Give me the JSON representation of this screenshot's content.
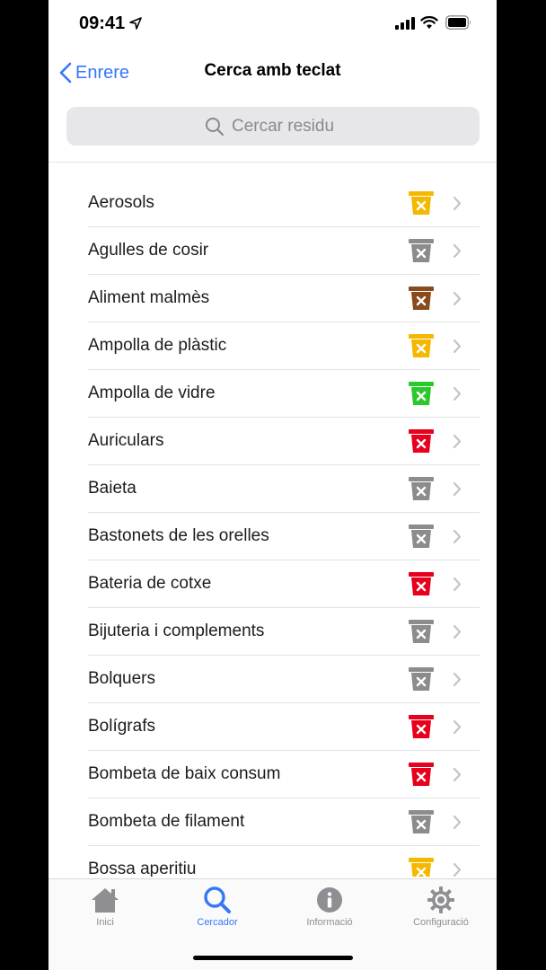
{
  "status_bar": {
    "time": "09:41"
  },
  "nav": {
    "back_label": "Enrere",
    "title": "Cerca amb teclat"
  },
  "search": {
    "placeholder": "Cercar residu"
  },
  "colors": {
    "yellow": "#f5b800",
    "gray": "#8c8c8c",
    "brown": "#8a4a1c",
    "green": "#2ac92a",
    "red": "#e8001c",
    "accent": "#3478f6"
  },
  "items": [
    {
      "label": "Aerosols",
      "bin": "yellow"
    },
    {
      "label": "Agulles de cosir",
      "bin": "gray"
    },
    {
      "label": "Aliment malmès",
      "bin": "brown"
    },
    {
      "label": "Ampolla de plàstic",
      "bin": "yellow"
    },
    {
      "label": "Ampolla de vidre",
      "bin": "green"
    },
    {
      "label": "Auriculars",
      "bin": "red"
    },
    {
      "label": "Baieta",
      "bin": "gray"
    },
    {
      "label": "Bastonets de les orelles",
      "bin": "gray"
    },
    {
      "label": "Bateria de cotxe",
      "bin": "red"
    },
    {
      "label": "Bijuteria i complements",
      "bin": "gray"
    },
    {
      "label": "Bolquers",
      "bin": "gray"
    },
    {
      "label": "Bolígrafs",
      "bin": "red"
    },
    {
      "label": "Bombeta de baix consum",
      "bin": "red"
    },
    {
      "label": "Bombeta de filament",
      "bin": "gray"
    },
    {
      "label": "Bossa aperitiu",
      "bin": "yellow"
    }
  ],
  "tabbar": {
    "tabs": [
      {
        "label": "Inici",
        "icon": "house-icon"
      },
      {
        "label": "Cercador",
        "icon": "magnifier-icon"
      },
      {
        "label": "Informació",
        "icon": "info-icon"
      },
      {
        "label": "Configuració",
        "icon": "gear-icon"
      }
    ]
  }
}
